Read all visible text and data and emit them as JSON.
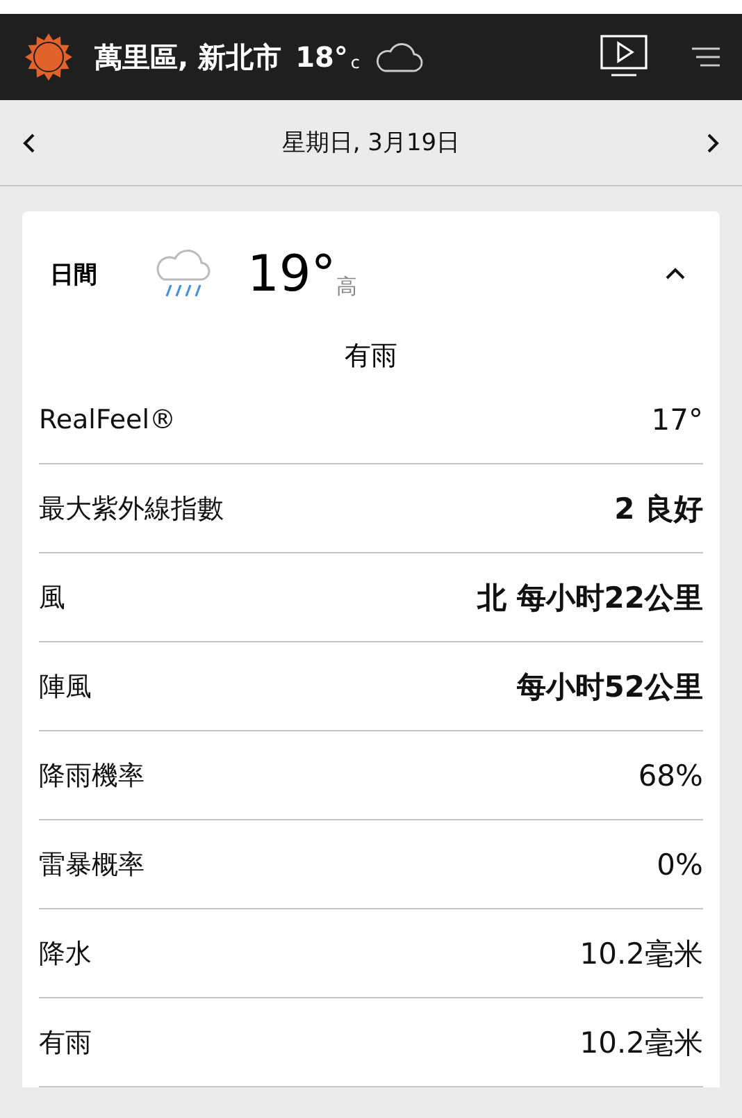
{
  "header": {
    "location": "萬里區, 新北市",
    "temperature": "18°",
    "unit": "c"
  },
  "date_bar": {
    "date": "星期日, 3月19日"
  },
  "day_card": {
    "label": "日間",
    "temperature": "19°",
    "temperature_label": "高",
    "expanded": true,
    "condition": "有雨",
    "rows": [
      {
        "label": "RealFeel®",
        "value": "17°",
        "bold": false
      },
      {
        "label": "最大紫外線指數",
        "value": "2 良好",
        "bold": true
      },
      {
        "label": "風",
        "value": "北 每小时22公里",
        "bold": true
      },
      {
        "label": "陣風",
        "value": "每小时52公里",
        "bold": true
      },
      {
        "label": "降雨機率",
        "value": "68%",
        "bold": false
      },
      {
        "label": "雷暴概率",
        "value": "0%",
        "bold": false
      },
      {
        "label": "降水",
        "value": "10.2毫米",
        "bold": false
      },
      {
        "label": "有雨",
        "value": "10.2毫米",
        "bold": false
      }
    ]
  }
}
